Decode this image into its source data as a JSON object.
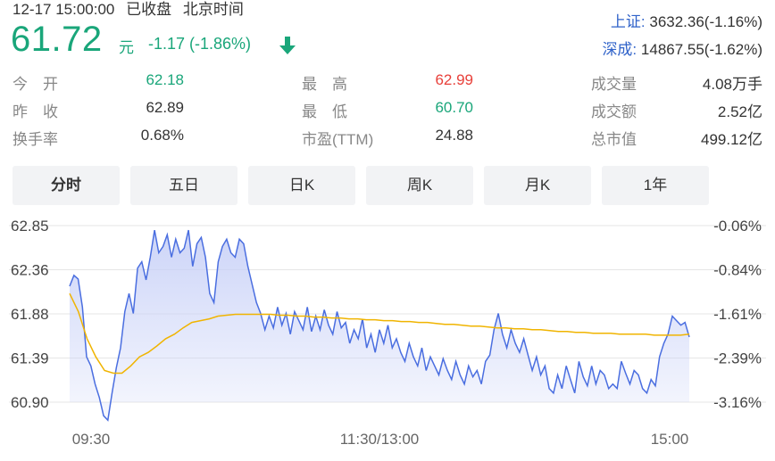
{
  "status": {
    "datetime": "12-17 15:00:00",
    "market_state": "已收盘",
    "timezone": "北京时间"
  },
  "price": {
    "current": "61.72",
    "unit": "元",
    "change": "-1.17 (-1.86%)",
    "direction": "down",
    "color": "#1aa67a"
  },
  "indices": [
    {
      "name": "上证:",
      "value": "3632.36(-1.16%)"
    },
    {
      "name": "深成:",
      "value": "14867.55(-1.62%)"
    }
  ],
  "stats": {
    "open": {
      "label": "今　开",
      "value": "62.18"
    },
    "prev_close": {
      "label": "昨　收",
      "value": "62.89"
    },
    "turnover_rate": {
      "label": "换手率",
      "value": "0.68%"
    },
    "high": {
      "label": "最　高",
      "value": "62.99"
    },
    "low": {
      "label": "最　低",
      "value": "60.70"
    },
    "pe_ttm": {
      "label": "市盈(TTM)",
      "value": "24.88"
    },
    "volume": {
      "label": "成交量",
      "value": "4.08万手"
    },
    "amount": {
      "label": "成交额",
      "value": "2.52亿"
    },
    "market_cap": {
      "label": "总市值",
      "value": "499.12亿"
    }
  },
  "tabs": [
    {
      "label": "分时",
      "active": true
    },
    {
      "label": "五日",
      "active": false
    },
    {
      "label": "日K",
      "active": false
    },
    {
      "label": "周K",
      "active": false
    },
    {
      "label": "月K",
      "active": false
    },
    {
      "label": "1年",
      "active": false
    }
  ],
  "chart_data": {
    "type": "line",
    "title": "",
    "y_ticks": [
      "62.85",
      "62.36",
      "61.88",
      "61.39",
      "60.90"
    ],
    "y_pct_ticks": [
      "-0.06%",
      "-0.84%",
      "-1.61%",
      "-2.39%",
      "-3.16%"
    ],
    "ylim": [
      60.9,
      62.85
    ],
    "x_ticks": [
      "09:30",
      "11:30/13:00",
      "15:00"
    ],
    "colors": {
      "price": "#4a6ee0",
      "average": "#f0b400",
      "fill": "#c7d0f7",
      "grid": "#e6e6e6"
    },
    "series": [
      {
        "values": [
          62.18,
          62.3,
          62.26,
          61.95,
          61.4,
          61.3,
          61.1,
          60.95,
          60.75,
          60.7,
          61.0,
          61.28,
          61.5,
          61.9,
          62.1,
          61.88,
          62.38,
          62.45,
          62.25,
          62.5,
          62.8,
          62.55,
          62.62,
          62.75,
          62.5,
          62.7,
          62.55,
          62.6,
          62.8,
          62.4,
          62.65,
          62.72,
          62.5,
          62.1,
          62.0,
          62.45,
          62.62,
          62.7,
          62.55,
          62.5,
          62.7,
          62.65,
          62.4,
          62.2,
          62.0,
          61.88,
          61.7,
          61.85,
          61.72,
          61.95,
          61.75,
          61.88,
          61.65,
          61.9,
          61.8,
          61.7,
          61.95,
          61.68,
          61.85,
          61.7,
          61.92,
          61.75,
          61.65,
          61.9,
          61.72,
          61.78,
          61.55,
          61.7,
          61.6,
          61.82,
          61.5,
          61.65,
          61.45,
          61.7,
          61.55,
          61.75,
          61.5,
          61.6,
          61.45,
          61.35,
          61.55,
          61.4,
          61.3,
          61.5,
          61.25,
          61.4,
          61.3,
          61.2,
          61.38,
          61.25,
          61.15,
          61.35,
          61.2,
          61.1,
          61.3,
          61.18,
          61.25,
          61.1,
          61.35,
          61.42,
          61.7,
          61.88,
          61.65,
          61.5,
          61.7,
          61.55,
          61.45,
          61.6,
          61.42,
          61.25,
          61.4,
          61.2,
          61.3,
          61.05,
          61.0,
          61.2,
          61.05,
          61.3,
          61.15,
          61.0,
          61.35,
          61.18,
          61.08,
          61.3,
          61.1,
          61.25,
          61.2,
          61.05,
          61.1,
          61.05,
          61.35,
          61.22,
          61.1,
          61.25,
          61.2,
          61.05,
          61.0,
          61.15,
          61.08,
          61.4,
          61.55,
          61.65,
          61.85,
          61.8,
          61.75,
          61.78,
          61.62
        ]
      },
      {
        "values": [
          62.1,
          61.9,
          61.6,
          61.4,
          61.25,
          61.22,
          61.22,
          61.3,
          61.4,
          61.45,
          61.52,
          61.6,
          61.65,
          61.72,
          61.78,
          61.8,
          61.82,
          61.85,
          61.86,
          61.87,
          61.87,
          61.87,
          61.87,
          61.87,
          61.86,
          61.86,
          61.85,
          61.85,
          61.84,
          61.84,
          61.83,
          61.83,
          61.82,
          61.82,
          61.81,
          61.81,
          61.8,
          61.8,
          61.79,
          61.79,
          61.78,
          61.78,
          61.77,
          61.76,
          61.76,
          61.75,
          61.74,
          61.74,
          61.73,
          61.72,
          61.72,
          61.71,
          61.71,
          61.7,
          61.7,
          61.69,
          61.68,
          61.68,
          61.67,
          61.67,
          61.66,
          61.66,
          61.66,
          61.65,
          61.65,
          61.65,
          61.65,
          61.64,
          61.64,
          61.64,
          61.64,
          61.65
        ]
      }
    ]
  }
}
